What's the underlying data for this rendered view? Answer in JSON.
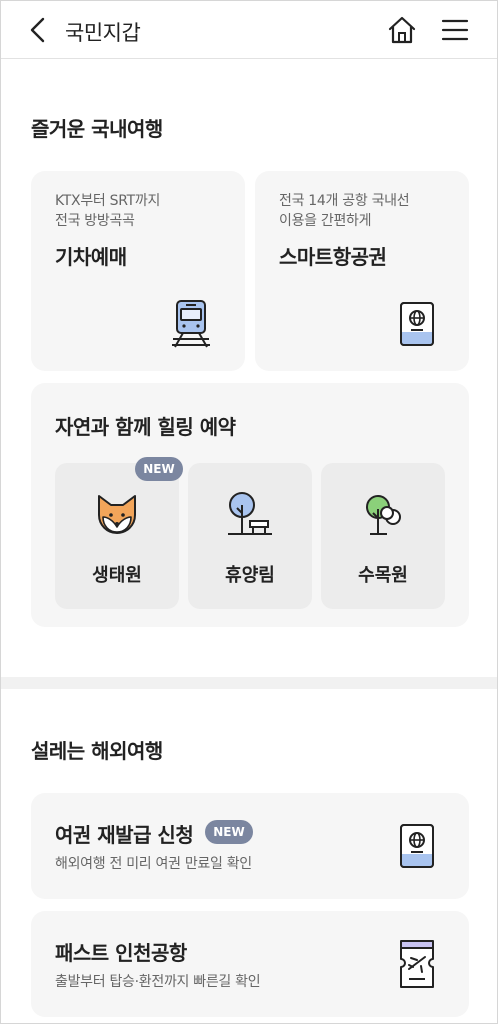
{
  "header": {
    "title": "국민지갑",
    "back_icon": "chevron-left-icon",
    "home_icon": "home-icon",
    "menu_icon": "hamburger-menu-icon"
  },
  "domestic": {
    "title": "즐거운 국내여행",
    "train": {
      "sub1": "KTX부터 SRT까지",
      "sub2": "전국 방방곡곡",
      "label": "기차예매",
      "icon": "train-icon"
    },
    "flight": {
      "sub1": "전국 14개 공항 국내선",
      "sub2": "이용을 간편하게",
      "label": "스마트항공권",
      "icon": "passport-icon"
    },
    "nature": {
      "title": "자연과 함께 힐링 예약",
      "badge": "NEW",
      "items": [
        {
          "label": "생태원",
          "icon": "fox-icon"
        },
        {
          "label": "휴양림",
          "icon": "tree-bench-icon"
        },
        {
          "label": "수목원",
          "icon": "tree-icon"
        }
      ]
    }
  },
  "overseas": {
    "title": "설레는 해외여행",
    "passport": {
      "label": "여권 재발급 신청",
      "badge": "NEW",
      "sub": "해외여행 전 미리 여권 만료일 확인",
      "icon": "passport-icon"
    },
    "fast": {
      "label": "패스트 인천공항",
      "sub": "출발부터 탑승·환전까지 빠른길 확인",
      "icon": "boarding-ticket-icon"
    }
  },
  "colors": {
    "card_bg": "#f6f6f6",
    "inner_bg": "#ececec",
    "badge": "#7b86a0",
    "icon_blue": "#a9c4ef",
    "icon_lavender": "#c9c4f2",
    "icon_green": "#8bd07a"
  }
}
